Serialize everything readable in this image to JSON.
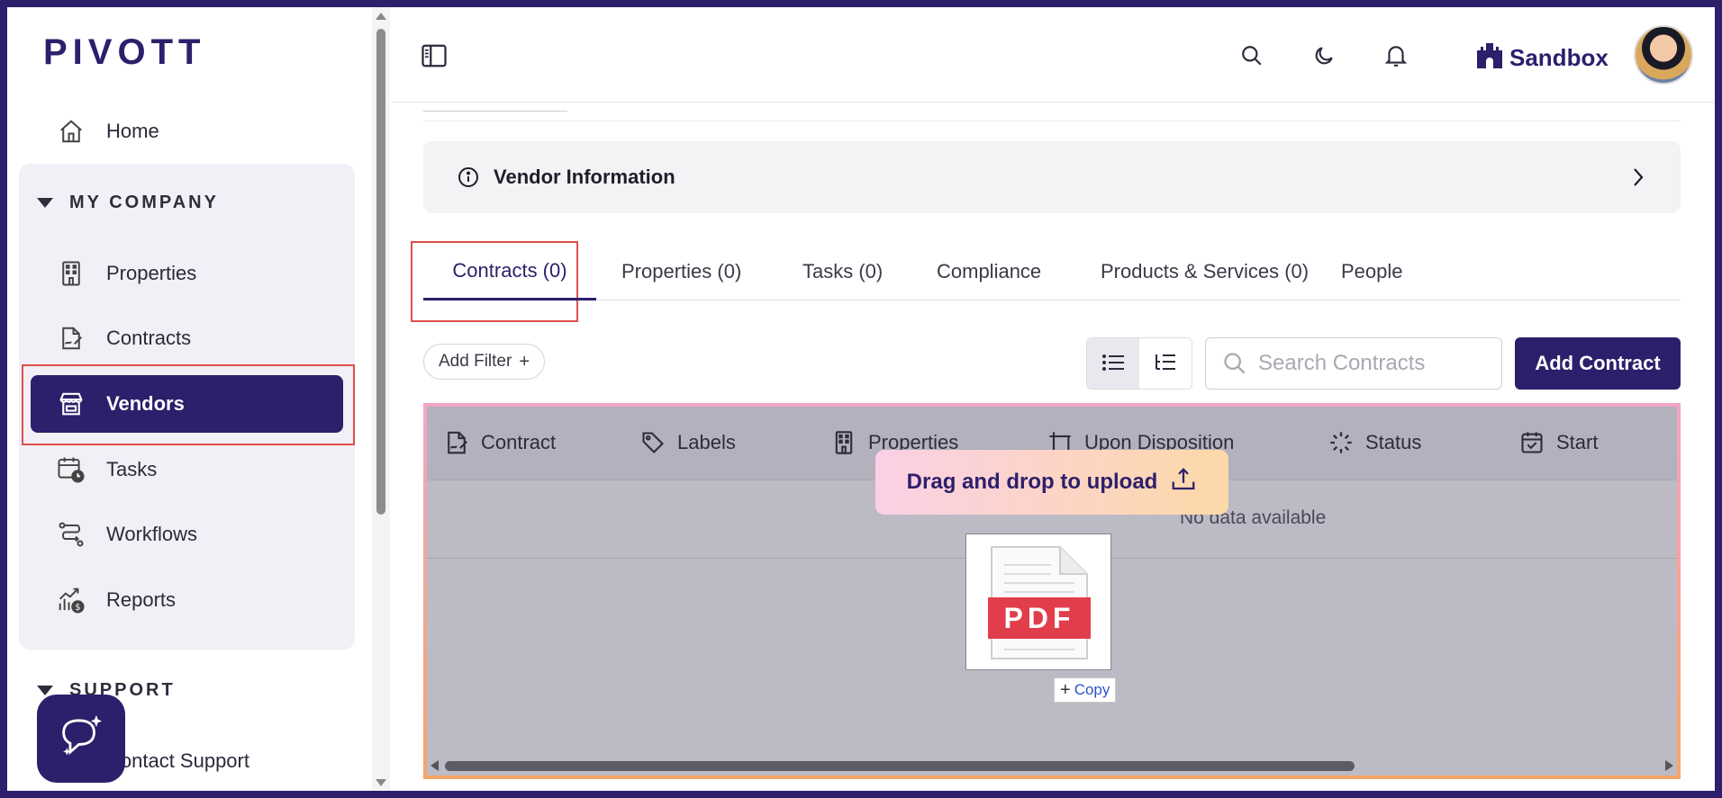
{
  "sidebar": {
    "logo": "PIVOTT",
    "home": "Home",
    "my_company": {
      "title": "MY COMPANY",
      "items": [
        {
          "label": "Properties",
          "icon": "building-icon"
        },
        {
          "label": "Contracts",
          "icon": "contract-sign-icon"
        },
        {
          "label": "Vendors",
          "icon": "storefront-icon"
        },
        {
          "label": "Tasks",
          "icon": "calendar-clock-icon"
        },
        {
          "label": "Workflows",
          "icon": "workflow-icon"
        },
        {
          "label": "Reports",
          "icon": "chart-dollar-icon"
        }
      ]
    },
    "support": {
      "title": "SUPPORT",
      "items": [
        {
          "label": "Contact Support"
        }
      ]
    }
  },
  "header": {
    "org": "Sandbox"
  },
  "vendor_section": {
    "title": "Vendor Information"
  },
  "tabs": [
    {
      "label": "Contracts (0)"
    },
    {
      "label": "Properties (0)"
    },
    {
      "label": "Tasks (0)"
    },
    {
      "label": "Compliance"
    },
    {
      "label": "Products & Services (0)"
    },
    {
      "label": "People"
    }
  ],
  "toolbar": {
    "add_filter": "Add Filter",
    "search_placeholder": "Search Contracts",
    "add_contract": "Add Contract"
  },
  "table": {
    "columns": [
      {
        "label": "Contract",
        "icon": "contract-sign-icon"
      },
      {
        "label": "Labels",
        "icon": "tag-icon"
      },
      {
        "label": "Properties",
        "icon": "building-icon"
      },
      {
        "label": "Upon Disposition",
        "icon": "frame-icon"
      },
      {
        "label": "Status",
        "icon": "spinner-icon"
      },
      {
        "label": "Start",
        "icon": "calendar-check-icon"
      }
    ],
    "empty_text": "No data available"
  },
  "drag_overlay": {
    "message": "Drag and drop to upload",
    "file_badge": "PDF",
    "copy_label": "Copy"
  },
  "colors": {
    "brand": "#2d1f6b",
    "highlight": "#e04f4f",
    "pdf_red": "#e23d4b"
  }
}
